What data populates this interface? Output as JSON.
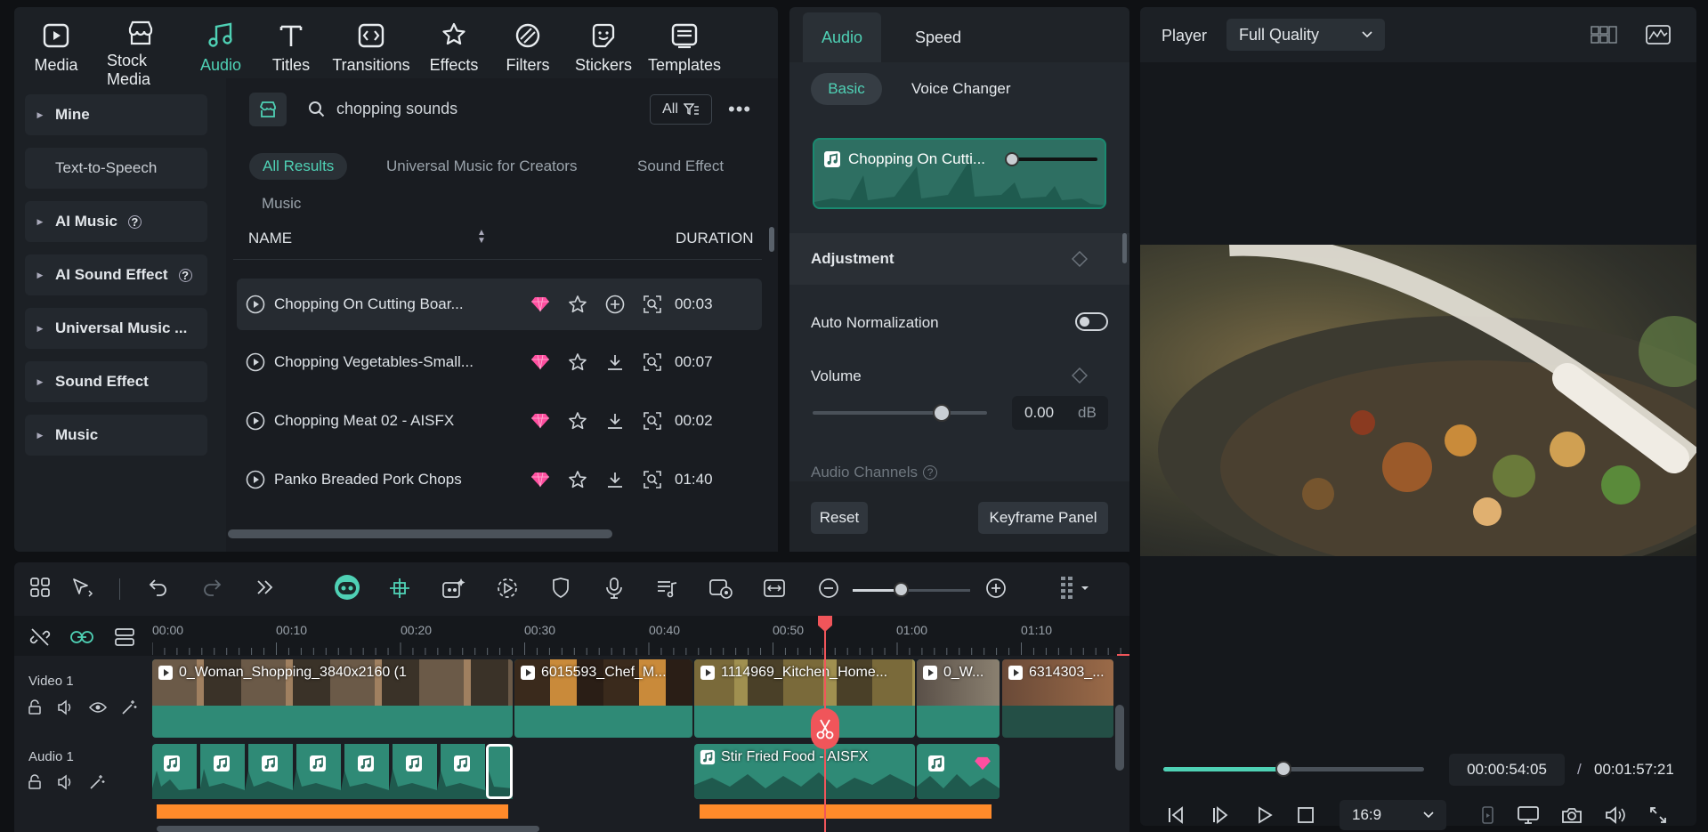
{
  "top_tabs": [
    {
      "label": "Media",
      "icon": "media-icon"
    },
    {
      "label": "Stock Media",
      "icon": "stock-media-icon"
    },
    {
      "label": "Audio",
      "icon": "audio-note-icon",
      "active": true
    },
    {
      "label": "Titles",
      "icon": "titles-icon"
    },
    {
      "label": "Transitions",
      "icon": "transitions-icon"
    },
    {
      "label": "Effects",
      "icon": "effects-icon"
    },
    {
      "label": "Filters",
      "icon": "filters-icon"
    },
    {
      "label": "Stickers",
      "icon": "stickers-icon"
    },
    {
      "label": "Templates",
      "icon": "templates-icon"
    }
  ],
  "sidebar": {
    "items": [
      {
        "label": "Mine"
      },
      {
        "label": "Text-to-Speech"
      },
      {
        "label": "AI Music"
      },
      {
        "label": "AI Sound Effect"
      },
      {
        "label": "Universal Music ..."
      },
      {
        "label": "Sound Effect"
      },
      {
        "label": "Music"
      }
    ]
  },
  "search": {
    "value": "chopping sounds",
    "filter_label": "All"
  },
  "result_tabs": [
    "All Results",
    "Universal Music for Creators",
    "Sound Effect",
    "Music"
  ],
  "columns": {
    "name": "NAME",
    "duration": "DURATION"
  },
  "results": [
    {
      "name": "Chopping On Cutting Boar...",
      "duration": "00:03",
      "action": "add"
    },
    {
      "name": "Chopping Vegetables-Small...",
      "duration": "00:07",
      "action": "download"
    },
    {
      "name": "Chopping Meat 02 - AISFX",
      "duration": "00:02",
      "action": "download"
    },
    {
      "name": "Panko Breaded Pork Chops",
      "duration": "01:40",
      "action": "download"
    }
  ],
  "props": {
    "tabs": [
      "Audio",
      "Speed"
    ],
    "subtabs": [
      "Basic",
      "Voice Changer"
    ],
    "clip_name": "Chopping On Cutti...",
    "adjustment": "Adjustment",
    "auto_normalization": "Auto Normalization",
    "auto_normalization_on": false,
    "volume_label": "Volume",
    "volume_value": "0.00",
    "volume_unit": "dB",
    "volume_level": 0.74,
    "audio_channels": "Audio Channels",
    "reset": "Reset",
    "keyframe": "Keyframe Panel"
  },
  "player": {
    "label": "Player",
    "quality": "Full Quality",
    "current_time": "00:00:54:05",
    "separator": "/",
    "total_time": "00:01:57:21",
    "aspect": "16:9",
    "progress": 0.46
  },
  "timeline": {
    "ticks": [
      "00:00",
      "00:10",
      "00:20",
      "00:30",
      "00:40",
      "00:50",
      "01:00",
      "01:10"
    ],
    "tracks": {
      "video": "Video 1",
      "audio": "Audio 1"
    },
    "video_clips": [
      "0_Woman_Shopping_3840x2160 (1",
      "6015593_Chef_M...",
      "1114969_Kitchen_Home...",
      "0_W...",
      "6314303_..."
    ],
    "audio_clip": "Stir Fried Food - AISFX"
  },
  "colors": {
    "accent": "#4fd1b5",
    "panel": "#1c2025",
    "playhead": "#f0555a",
    "orange": "#ff8a2a",
    "clip_green": "#3a8f7c",
    "gem": "#ff4fa0"
  }
}
